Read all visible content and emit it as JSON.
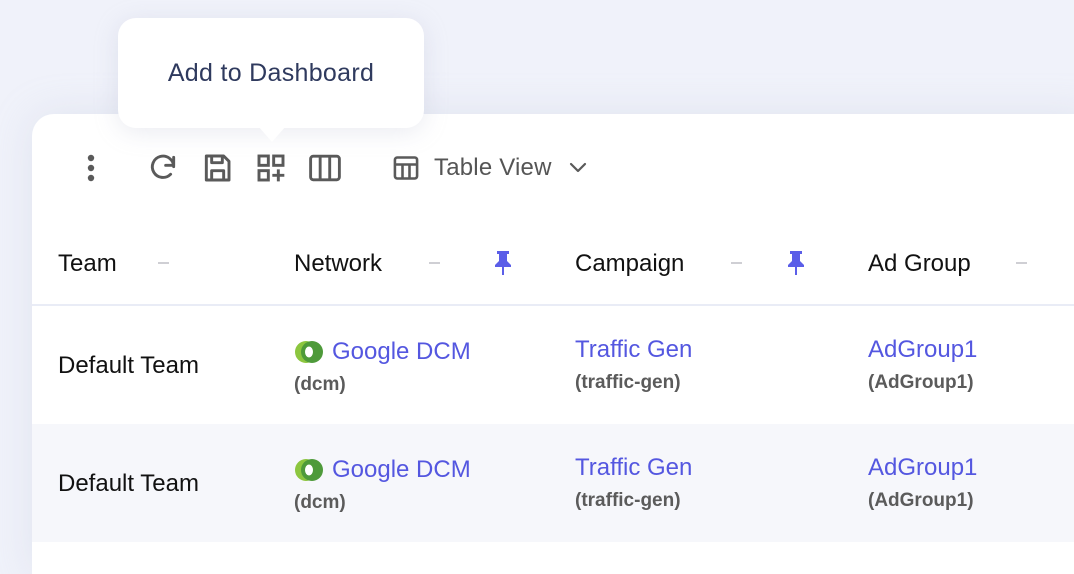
{
  "tooltip": {
    "text": "Add to Dashboard"
  },
  "toolbar": {
    "icons": [
      "more-vertical-icon",
      "refresh-icon",
      "save-icon",
      "add-to-dashboard-icon",
      "columns-icon"
    ],
    "view_select": {
      "icon": "table-icon",
      "label": "Table View",
      "chevron": "chevron-down-icon"
    }
  },
  "table": {
    "columns": [
      {
        "label": "Team",
        "sortable": true,
        "pinned": false
      },
      {
        "label": "Network",
        "sortable": true,
        "pinned": true
      },
      {
        "label": "Campaign",
        "sortable": true,
        "pinned": true
      },
      {
        "label": "Ad Group",
        "sortable": true,
        "pinned": false
      }
    ],
    "rows": [
      {
        "team": "Default Team",
        "network": {
          "name": "Google DCM",
          "code": "(dcm)",
          "icon": "google-dcm-logo"
        },
        "campaign": {
          "name": "Traffic Gen",
          "code": "(traffic-gen)"
        },
        "ad_group": {
          "name": "AdGroup1",
          "code": "(AdGroup1)"
        }
      },
      {
        "team": "Default Team",
        "network": {
          "name": "Google DCM",
          "code": "(dcm)",
          "icon": "google-dcm-logo"
        },
        "campaign": {
          "name": "Traffic Gen",
          "code": "(traffic-gen)"
        },
        "ad_group": {
          "name": "AdGroup1",
          "code": "(AdGroup1)"
        }
      }
    ]
  },
  "colors": {
    "link": "#5457e0",
    "pin": "#5b5ee8",
    "tooltip_text": "#2f3a5e",
    "background": "#f0f2fa",
    "row_alt": "#f6f7fb"
  }
}
